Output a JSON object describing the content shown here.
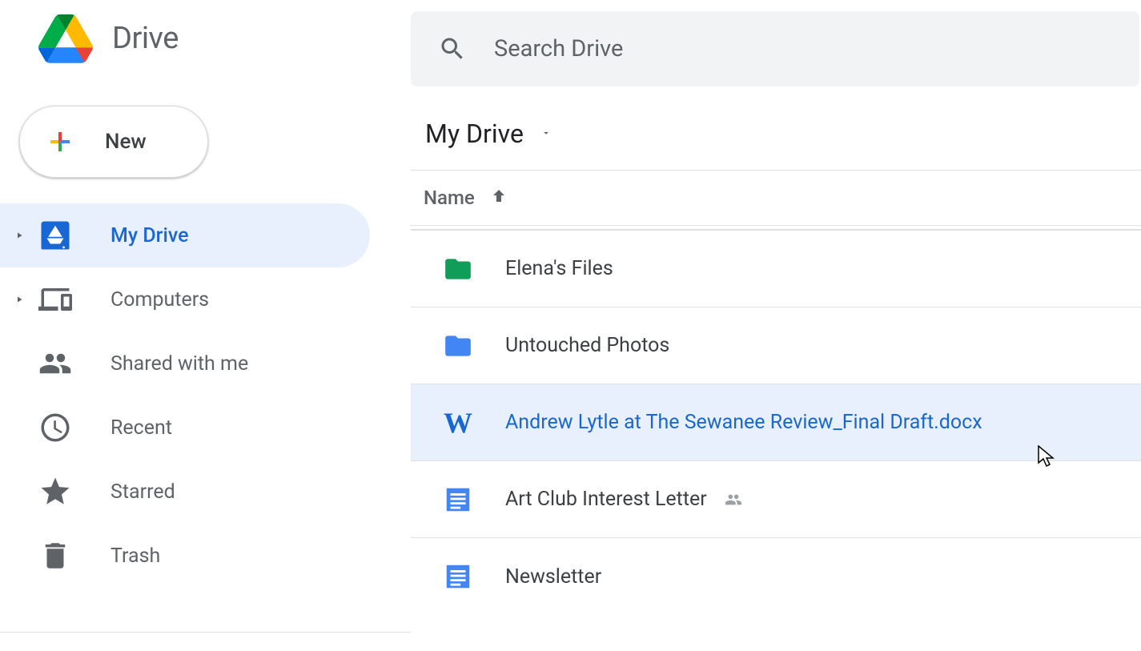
{
  "app_name": "Drive",
  "new_button_label": "New",
  "search_placeholder": "Search Drive",
  "breadcrumb": "My Drive",
  "list_header": {
    "name_col": "Name"
  },
  "sidebar": {
    "items": [
      {
        "label": "My Drive",
        "icon": "drive",
        "active": true,
        "expandable": true
      },
      {
        "label": "Computers",
        "icon": "computers",
        "active": false,
        "expandable": true
      },
      {
        "label": "Shared with me",
        "icon": "shared",
        "active": false,
        "expandable": false
      },
      {
        "label": "Recent",
        "icon": "recent",
        "active": false,
        "expandable": false
      },
      {
        "label": "Starred",
        "icon": "star",
        "active": false,
        "expandable": false
      },
      {
        "label": "Trash",
        "icon": "trash",
        "active": false,
        "expandable": false
      }
    ]
  },
  "files": [
    {
      "name": "Elena's Files",
      "type": "folder",
      "color": "#0f9d58",
      "shared": false,
      "selected": false
    },
    {
      "name": "Untouched Photos",
      "type": "folder",
      "color": "#4285f4",
      "shared": false,
      "selected": false
    },
    {
      "name": "Andrew Lytle at The Sewanee Review_Final Draft.docx",
      "type": "word",
      "shared": false,
      "selected": true
    },
    {
      "name": "Art Club Interest Letter",
      "type": "doc",
      "shared": true,
      "selected": false
    },
    {
      "name": "Newsletter",
      "type": "doc",
      "shared": false,
      "selected": false
    }
  ]
}
